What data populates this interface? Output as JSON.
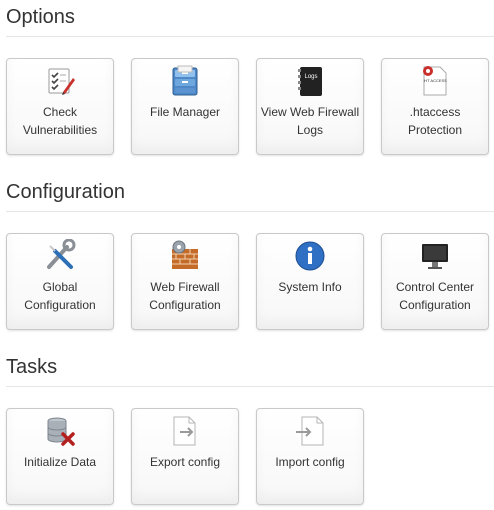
{
  "sections": [
    {
      "title": "Options",
      "tiles": [
        {
          "label": "Check\nVulnerabilities",
          "icon": "checklist-pen-icon"
        },
        {
          "label": "File Manager",
          "icon": "file-cabinet-icon"
        },
        {
          "label": "View Web Firewall\nLogs",
          "icon": "logs-book-icon"
        },
        {
          "label": ".htaccess\nProtection",
          "icon": "htaccess-file-icon"
        }
      ]
    },
    {
      "title": "Configuration",
      "tiles": [
        {
          "label": "Global\nConfiguration",
          "icon": "wrench-screwdriver-icon"
        },
        {
          "label": "Web Firewall\nConfiguration",
          "icon": "firewall-gear-icon"
        },
        {
          "label": "System Info",
          "icon": "info-icon"
        },
        {
          "label": "Control Center\nConfiguration",
          "icon": "monitor-icon"
        }
      ]
    },
    {
      "title": "Tasks",
      "tiles": [
        {
          "label": "Initialize Data",
          "icon": "database-delete-icon"
        },
        {
          "label": "Export config",
          "icon": "export-document-icon"
        },
        {
          "label": "Import config",
          "icon": "import-document-icon"
        }
      ]
    }
  ],
  "icon_text": {
    "logs": "Logs",
    "htaccess": ".HT ACCESS"
  }
}
